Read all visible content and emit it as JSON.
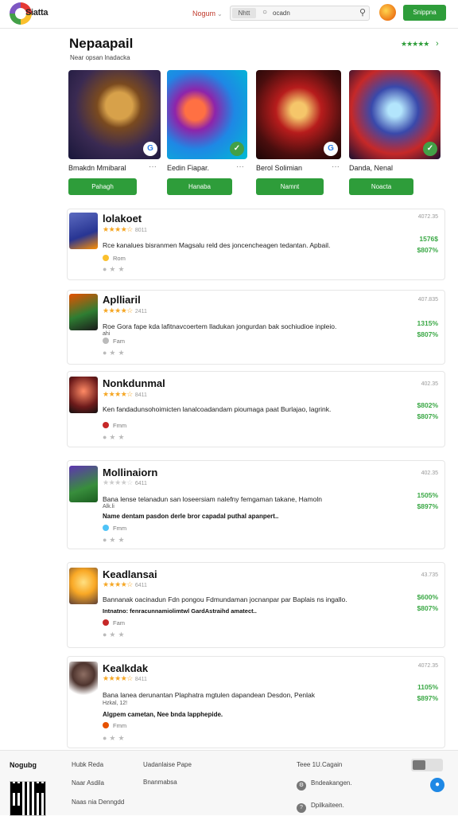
{
  "header": {
    "brand": "Siatta",
    "nav_link": "Nogum",
    "search_tag": "Nhtt",
    "search_placeholder": "ocadn",
    "signin_label": "Snippna"
  },
  "section": {
    "title": "Nepaapail",
    "subtitle": "Near opsan lnadacka",
    "stars": "★★★★★"
  },
  "featured": [
    {
      "name": "Bmakdn Mmibaral",
      "button": "Pahagh",
      "badge": "G"
    },
    {
      "name": "Eedin Fiapar.",
      "button": "Hanaba",
      "badge": "✓"
    },
    {
      "name": "Berol Solimian",
      "button": "Namnt",
      "badge": "G"
    },
    {
      "name": "Danda, Nenal",
      "button": "Noacta",
      "badge": "✓"
    }
  ],
  "items": [
    {
      "title": "lolakoet",
      "rating": "★★★★☆",
      "rating_num": "8011",
      "desc": "Rce kanalues bisranmen Magsalu reld des joncencheagen tedantan. Apbail.",
      "desc2": "",
      "desc3": "",
      "dev": "Rom",
      "meta": "4072.35",
      "price1": "1576$",
      "price2": "$807%"
    },
    {
      "title": "Aplliaril",
      "rating": "★★★★☆",
      "rating_num": "2411",
      "desc": "Roe Gora fape kda lafitnavcoertem lladukan jongurdan bak sochiudioe inpleio.",
      "desc2": "ahi",
      "desc3": "",
      "dev": "Fam",
      "meta": "407.835",
      "price1": "1315%",
      "price2": "$807%"
    },
    {
      "title": "Nonkdunmal",
      "rating": "★★★★☆",
      "rating_num": "8411",
      "desc": "Ken fandadunsohoimicten lanalcoadandam pioumaga paat Burlajao, lagrink.",
      "desc2": "",
      "desc3": "",
      "dev": "Fmm",
      "meta": "402.35",
      "price1": "$802%",
      "price2": "$807%"
    },
    {
      "title": "Mollinaiorn",
      "rating": "★★★★☆",
      "rating_num": "6411",
      "desc": "Bana lense telanadun san loseersiam nalefny femgaman takane, Hamoln",
      "desc2": "Alk.li",
      "desc3": "Name dentam pasdon derle bror capadal puthal apanpert..",
      "dev": "Fmm",
      "meta": "402.35",
      "price1": "1505%",
      "price2": "$897%"
    },
    {
      "title": "Keadlansai",
      "rating": "★★★★☆",
      "rating_num": "6411",
      "desc": "Bannanak oacinadun Fdn pongou Fdmundaman jocnanpar par Baplais ns ingallo.",
      "desc2": "",
      "desc3": "Intnatno: fenracunnamiolimtwl GardAstraihd amatect..",
      "dev": "Fam",
      "meta": "43.735",
      "price1": "$600%",
      "price2": "$807%"
    },
    {
      "title": "Kealkdak",
      "rating": "★★★★☆",
      "rating_num": "8411",
      "desc": "Bana lanea derunantan Plaphatra mgtulen dapandean Desdon, Penlak",
      "desc2": "Hzkal, 12!",
      "desc3": "Algpem cametan, Nee bnda lapphepide.",
      "dev": "Fmm",
      "meta": "4072.35",
      "price1": "1105%",
      "price2": "$897%"
    }
  ],
  "footer": {
    "brand": "Nogubg",
    "col1": [
      "Hubk Reda",
      "Naar Asdila",
      "Naas nia Denngdd"
    ],
    "col2": [
      "Uadanlaise Pape",
      "Bnanmabsa"
    ],
    "col3": [
      "Teee 1U.Cagain",
      "Bndeakangen.",
      "Dpilkaiteen."
    ]
  }
}
